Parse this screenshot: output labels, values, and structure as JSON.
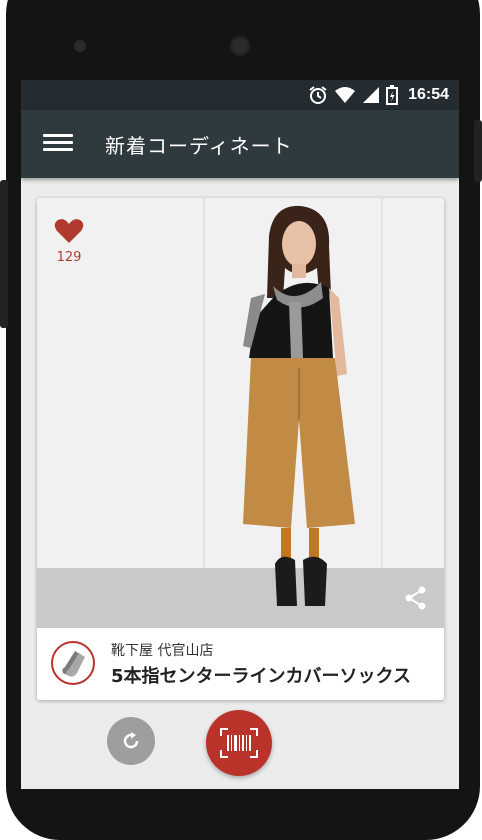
{
  "status_bar": {
    "time": "16:54",
    "icons": [
      "alarm-icon",
      "wifi-icon",
      "signal-icon",
      "battery-charging-icon"
    ]
  },
  "app_bar": {
    "title": "新着コーディネート",
    "menu_icon": "hamburger-menu-icon"
  },
  "card": {
    "like_count": "129",
    "like_icon": "heart-icon",
    "share_icon": "share-icon",
    "item": {
      "shop_name": "靴下屋 代官山店",
      "product_name": "5本指センターラインカバーソックス",
      "thumbnail_icon": "socks-thumbnail"
    }
  },
  "actions": {
    "refresh_icon": "refresh-icon",
    "scan_icon": "barcode-scan-icon"
  },
  "colors": {
    "status_bar": "#242c31",
    "app_bar": "#2f3a3f",
    "accent": "#b9332a",
    "like": "#b03a2e",
    "refresh": "#9e9e9e"
  }
}
